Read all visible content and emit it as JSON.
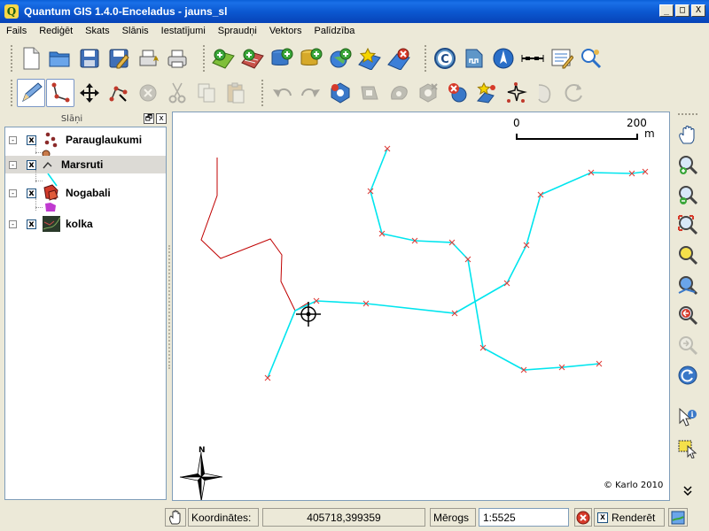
{
  "window": {
    "title": "Quantum GIS 1.4.0-Enceladus - jauns_sl",
    "app_icon": "Q",
    "minimize": "_",
    "maximize": "□",
    "close": "X"
  },
  "menu": [
    "Fails",
    "Rediģēt",
    "Skats",
    "Slānis",
    "Iestatījumi",
    "Spraudņi",
    "Vektors",
    "Palīdzība"
  ],
  "toolbar1": [
    "new-project-icon",
    "open-project-icon",
    "save-project-icon",
    "save-as-icon",
    "new-print-composer-icon",
    "print-icon",
    "add-vector-layer-icon",
    "add-raster-layer-icon",
    "add-postgis-layer-icon",
    "add-spatialite-layer-icon",
    "add-wms-layer-icon",
    "new-vector-layer-icon",
    "remove-layer-icon",
    "copyright-label-icon",
    "scalebar-icon",
    "north-arrow-icon",
    "scale-decoration-icon",
    "text-annotation-icon",
    "python-console-icon"
  ],
  "toolbar2": [
    "toggle-editing-icon",
    "capture-line-icon",
    "move-feature-icon",
    "node-tool-icon",
    "delete-selected-icon",
    "cut-features-icon",
    "copy-features-icon",
    "paste-features-icon",
    "undo-icon",
    "redo-icon",
    "add-ring-icon",
    "add-island-icon",
    "simplify-feature-icon",
    "delete-ring-icon",
    "delete-part-icon",
    "reshape-features-icon",
    "split-features-icon",
    "merge-features-icon",
    "rotate-point-symbols-icon"
  ],
  "layers_panel": {
    "title": "Slāņi",
    "float": "🗗",
    "close": "x",
    "layers": [
      {
        "name": "Parauglaukumi",
        "checked": "x",
        "expander": "-",
        "selected": false
      },
      {
        "name": "Marsruti",
        "checked": "x",
        "expander": "-",
        "selected": true
      },
      {
        "name": "Nogabali",
        "checked": "x",
        "expander": "-",
        "selected": false
      },
      {
        "name": "kolka",
        "checked": "x",
        "expander": "-",
        "selected": false
      }
    ]
  },
  "map": {
    "scalebar_start": "0",
    "scalebar_end": "200",
    "scalebar_unit": "m",
    "north_label": "N",
    "copyright": "© Karlo 2010",
    "colors": {
      "route": "#00e5ee",
      "vertex": "#e0403c",
      "edit_line": "#c00000"
    }
  },
  "right_toolbar": [
    "pan-icon",
    "zoom-in-icon",
    "zoom-out-icon",
    "zoom-full-icon",
    "zoom-to-selection-icon",
    "zoom-to-layer-icon",
    "zoom-last-icon",
    "zoom-next-icon",
    "refresh-icon",
    "identify-icon",
    "select-features-icon",
    "more-tools-icon"
  ],
  "statusbar": {
    "coords_label": "Koordinātes:",
    "coords_value": "405718,399359",
    "scale_label": "Mērogs",
    "scale_value": "1:5525",
    "render_label": "Renderēt",
    "render_checked": "x"
  }
}
